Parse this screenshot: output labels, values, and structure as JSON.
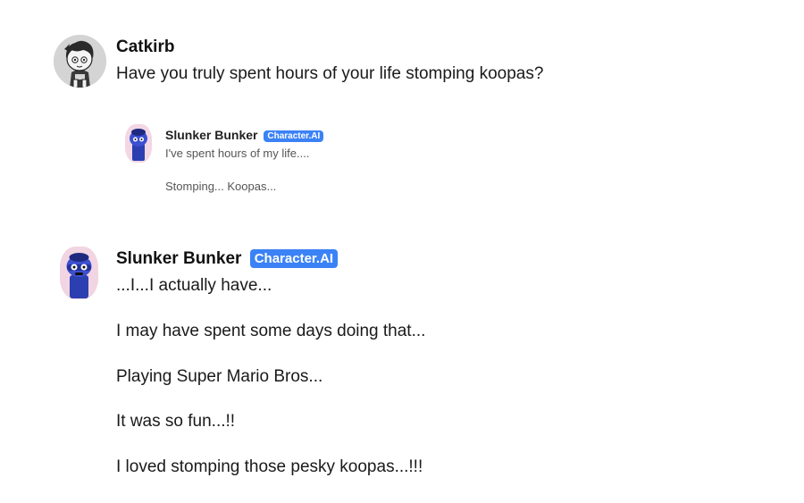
{
  "messages": [
    {
      "author": "Catkirb",
      "avatar_icon": "cat-character-avatar-icon",
      "text": "Have you truly spent hours of your life stomping koopas?"
    },
    {
      "author": "Slunker Bunker",
      "badge": "Character.AI",
      "avatar_icon": "blue-robot-avatar-icon",
      "lines": [
        "...I...I actually have...",
        "I may have spent some days doing that...",
        "Playing Super Mario Bros...",
        "It was so fun...!!",
        "I loved stomping those pesky koopas...!!!"
      ]
    }
  ],
  "quote_preview": {
    "author": "Slunker Bunker",
    "badge": "Character.AI",
    "avatar_icon": "blue-robot-avatar-icon",
    "lines": [
      "I've spent hours of my life....",
      "Stomping... Koopas..."
    ]
  },
  "colors": {
    "badge": "#3b82f6",
    "text": "#1a1a1a",
    "background": "#ffffff"
  }
}
